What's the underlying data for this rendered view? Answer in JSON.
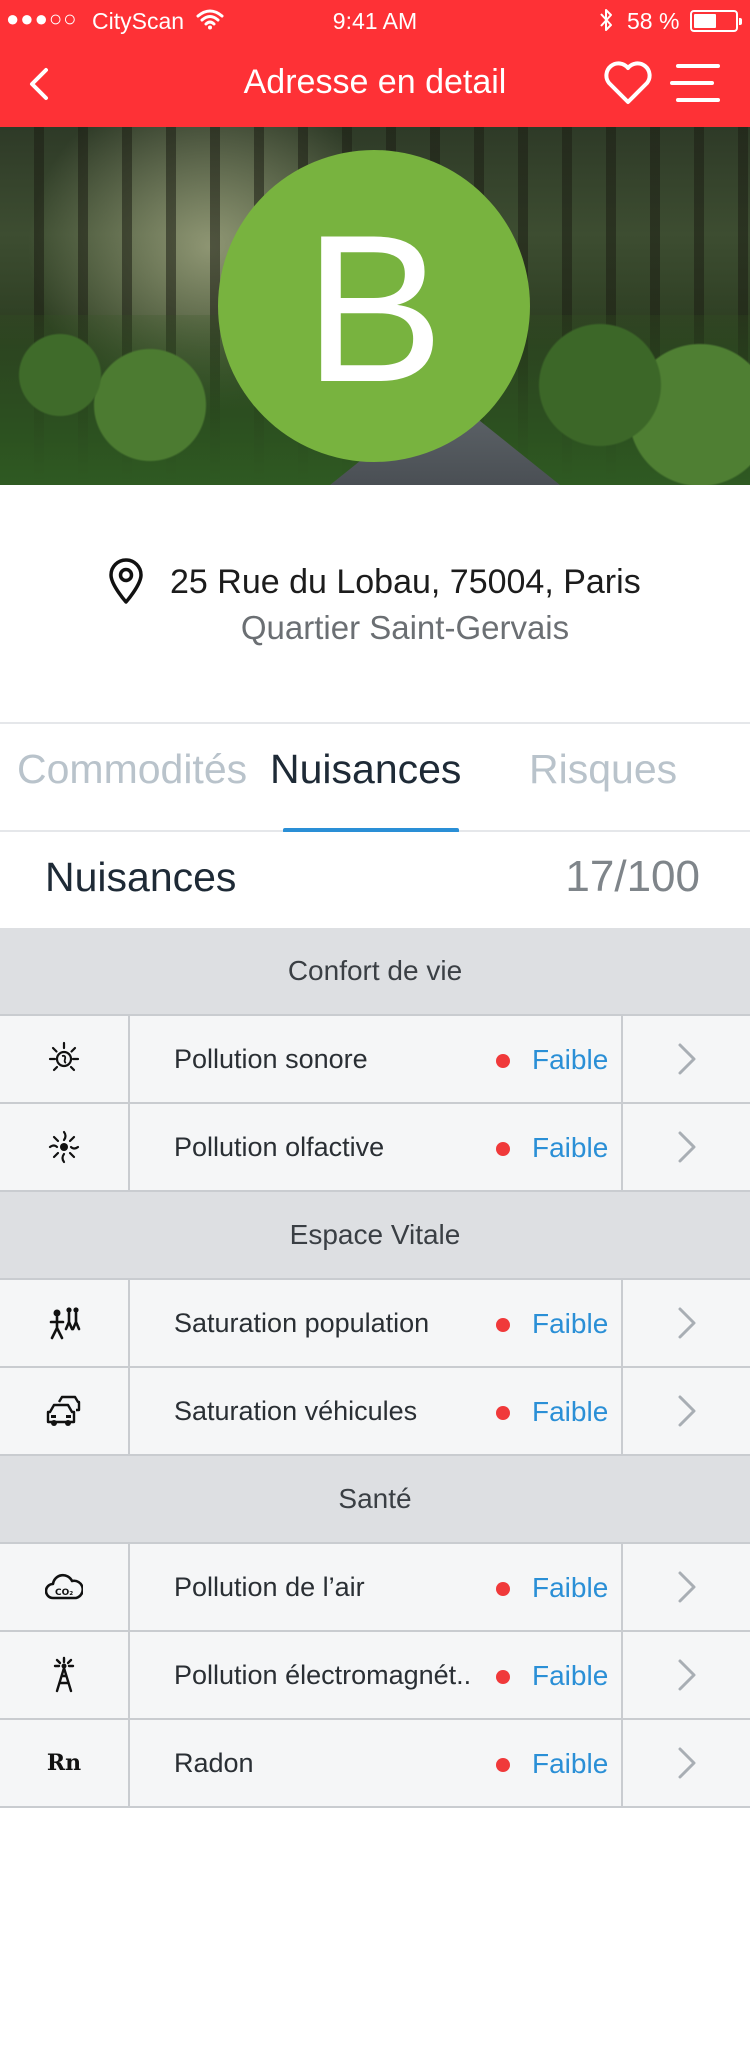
{
  "status_bar": {
    "signal": "●●●○○",
    "carrier": "CityScan",
    "time": "9:41 AM",
    "battery_pct": "58 %",
    "battery_level": 0.58
  },
  "nav": {
    "title": "Adresse en detail"
  },
  "hero": {
    "grade": "B",
    "grade_color": "#78b33f"
  },
  "address": {
    "street": "25 Rue du Lobau, 75004, Paris",
    "district": "Quartier Saint-Gervais"
  },
  "tabs": [
    {
      "label": "Commodités"
    },
    {
      "label": "Nuisances",
      "active": true
    },
    {
      "label": "Risques"
    }
  ],
  "score": {
    "title": "Nuisances",
    "value": "17/100"
  },
  "sections": [
    {
      "title": "Confort de vie",
      "rows": [
        {
          "icon": "sound-icon",
          "label": "Pollution sonore",
          "level": "Faible"
        },
        {
          "icon": "smell-icon",
          "label": "Pollution olfactive",
          "level": "Faible"
        }
      ]
    },
    {
      "title": "Espace Vitale",
      "rows": [
        {
          "icon": "people-icon",
          "label": "Saturation population",
          "level": "Faible"
        },
        {
          "icon": "cars-icon",
          "label": "Saturation véhicules",
          "level": "Faible"
        }
      ]
    },
    {
      "title": "Santé",
      "rows": [
        {
          "icon": "co2-cloud-icon",
          "label": "Pollution de l’air",
          "level": "Faible"
        },
        {
          "icon": "antenna-icon",
          "label": "Pollution électromagnét..",
          "level": "Faible"
        },
        {
          "icon": "radon-icon",
          "label": "Radon",
          "level": "Faible",
          "icon_text": "Rn"
        }
      ]
    }
  ],
  "colors": {
    "header": "#fe3136",
    "accent": "#2a8fd6",
    "level_dot": "#f0393a"
  }
}
